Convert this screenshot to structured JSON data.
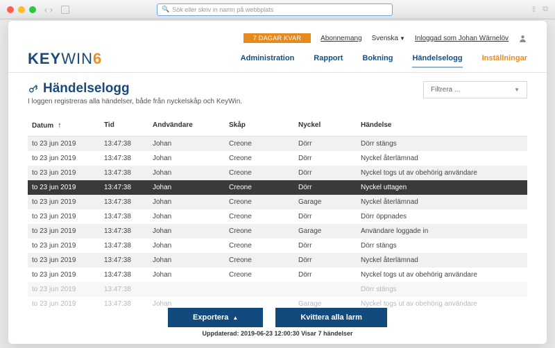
{
  "browser": {
    "placeholder": "Sök eller skriv in namn på webbplats"
  },
  "topbar": {
    "days_badge": "7 DAGAR KVAR",
    "subscription": "Abonnemang",
    "language": "Svenska",
    "logged_in": "Inloggad som Johan Wärnelöv"
  },
  "brand": {
    "part1": "KEY",
    "part2": "WIN",
    "part3": "6"
  },
  "nav": {
    "administration": "Administration",
    "rapport": "Rapport",
    "bokning": "Bokning",
    "handelselogg": "Händelselogg",
    "installningar": "Inställningar"
  },
  "page": {
    "title": "Händelselogg",
    "subtitle": "I loggen registreras alla händelser, både från nyckelskåp och KeyWin.",
    "filter_label": "Filtrera ..."
  },
  "columns": {
    "date": "Datum",
    "time": "Tid",
    "user": "Andvändare",
    "cabinet": "Skåp",
    "key": "Nyckel",
    "event": "Händelse"
  },
  "rows": [
    {
      "date": "to 23 jun 2019",
      "time": "13:47:38",
      "user": "Johan",
      "cabinet": "Creone",
      "key": "Dörr",
      "event": "Dörr stängs",
      "style": "stripe"
    },
    {
      "date": "to 23 jun 2019",
      "time": "13:47:38",
      "user": "Johan",
      "cabinet": "Creone",
      "key": "Dörr",
      "event": "Nyckel återlämnad",
      "style": ""
    },
    {
      "date": "to 23 jun 2019",
      "time": "13:47:38",
      "user": "Johan",
      "cabinet": "Creone",
      "key": "Dörr",
      "event": "Nyckel togs ut av obehörig användare",
      "style": "stripe"
    },
    {
      "date": "to 23 jun 2019",
      "time": "13:47:38",
      "user": "Johan",
      "cabinet": "Creone",
      "key": "Dörr",
      "event": "Nyckel uttagen",
      "style": "sel"
    },
    {
      "date": "to 23 jun 2019",
      "time": "13:47:38",
      "user": "Johan",
      "cabinet": "Creone",
      "key": "Garage",
      "event": "Nyckel återlämnad",
      "style": "stripe"
    },
    {
      "date": "to 23 jun 2019",
      "time": "13:47:38",
      "user": "Johan",
      "cabinet": "Creone",
      "key": "Dörr",
      "event": "Dörr öppnades",
      "style": ""
    },
    {
      "date": "to 23 jun 2019",
      "time": "13:47:38",
      "user": "Johan",
      "cabinet": "Creone",
      "key": "Garage",
      "event": "Användare loggade in",
      "style": "stripe"
    },
    {
      "date": "to 23 jun 2019",
      "time": "13:47:38",
      "user": "Johan",
      "cabinet": "Creone",
      "key": "Dörr",
      "event": "Dörr stängs",
      "style": ""
    },
    {
      "date": "to 23 jun 2019",
      "time": "13:47:38",
      "user": "Johan",
      "cabinet": "Creone",
      "key": "Dörr",
      "event": "Nyckel återlämnad",
      "style": "stripe"
    },
    {
      "date": "to 23 jun 2019",
      "time": "13:47:38",
      "user": "Johan",
      "cabinet": "Creone",
      "key": "Dörr",
      "event": "Nyckel togs ut av obehörig användare",
      "style": ""
    },
    {
      "date": "to 23 jun 2019",
      "time": "13:47:38",
      "user": "",
      "cabinet": "",
      "key": "",
      "event": "Dörr stängs",
      "style": "stripe faded"
    },
    {
      "date": "to 23 jun 2019",
      "time": "13:47:38",
      "user": "Johan",
      "cabinet": "",
      "key": "Garage",
      "event": "Nyckel togs ut av obehörig användare",
      "style": "faded"
    }
  ],
  "actions": {
    "export": "Exportera",
    "ack": "Kvittera alla larm"
  },
  "status": "Uppdaterad: 2019-06-23 12:00:30 Visar 7 händelser"
}
